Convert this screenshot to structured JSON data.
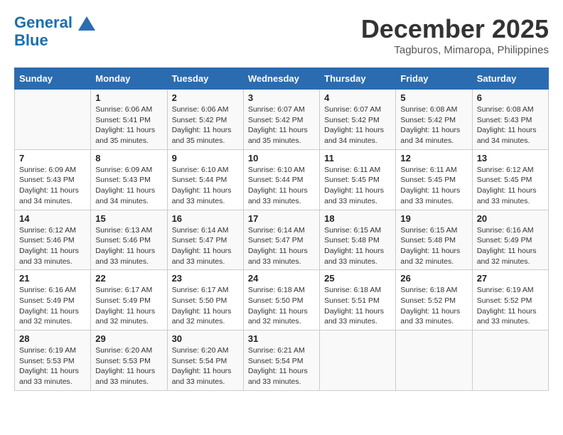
{
  "header": {
    "logo_line1": "General",
    "logo_line2": "Blue",
    "month": "December 2025",
    "location": "Tagburos, Mimaropa, Philippines"
  },
  "weekdays": [
    "Sunday",
    "Monday",
    "Tuesday",
    "Wednesday",
    "Thursday",
    "Friday",
    "Saturday"
  ],
  "weeks": [
    [
      {
        "day": "",
        "sunrise": "",
        "sunset": "",
        "daylight": ""
      },
      {
        "day": "1",
        "sunrise": "6:06 AM",
        "sunset": "5:41 PM",
        "daylight": "11 hours and 35 minutes."
      },
      {
        "day": "2",
        "sunrise": "6:06 AM",
        "sunset": "5:42 PM",
        "daylight": "11 hours and 35 minutes."
      },
      {
        "day": "3",
        "sunrise": "6:07 AM",
        "sunset": "5:42 PM",
        "daylight": "11 hours and 35 minutes."
      },
      {
        "day": "4",
        "sunrise": "6:07 AM",
        "sunset": "5:42 PM",
        "daylight": "11 hours and 34 minutes."
      },
      {
        "day": "5",
        "sunrise": "6:08 AM",
        "sunset": "5:42 PM",
        "daylight": "11 hours and 34 minutes."
      },
      {
        "day": "6",
        "sunrise": "6:08 AM",
        "sunset": "5:43 PM",
        "daylight": "11 hours and 34 minutes."
      }
    ],
    [
      {
        "day": "7",
        "sunrise": "6:09 AM",
        "sunset": "5:43 PM",
        "daylight": "11 hours and 34 minutes."
      },
      {
        "day": "8",
        "sunrise": "6:09 AM",
        "sunset": "5:43 PM",
        "daylight": "11 hours and 34 minutes."
      },
      {
        "day": "9",
        "sunrise": "6:10 AM",
        "sunset": "5:44 PM",
        "daylight": "11 hours and 33 minutes."
      },
      {
        "day": "10",
        "sunrise": "6:10 AM",
        "sunset": "5:44 PM",
        "daylight": "11 hours and 33 minutes."
      },
      {
        "day": "11",
        "sunrise": "6:11 AM",
        "sunset": "5:45 PM",
        "daylight": "11 hours and 33 minutes."
      },
      {
        "day": "12",
        "sunrise": "6:11 AM",
        "sunset": "5:45 PM",
        "daylight": "11 hours and 33 minutes."
      },
      {
        "day": "13",
        "sunrise": "6:12 AM",
        "sunset": "5:45 PM",
        "daylight": "11 hours and 33 minutes."
      }
    ],
    [
      {
        "day": "14",
        "sunrise": "6:12 AM",
        "sunset": "5:46 PM",
        "daylight": "11 hours and 33 minutes."
      },
      {
        "day": "15",
        "sunrise": "6:13 AM",
        "sunset": "5:46 PM",
        "daylight": "11 hours and 33 minutes."
      },
      {
        "day": "16",
        "sunrise": "6:14 AM",
        "sunset": "5:47 PM",
        "daylight": "11 hours and 33 minutes."
      },
      {
        "day": "17",
        "sunrise": "6:14 AM",
        "sunset": "5:47 PM",
        "daylight": "11 hours and 33 minutes."
      },
      {
        "day": "18",
        "sunrise": "6:15 AM",
        "sunset": "5:48 PM",
        "daylight": "11 hours and 33 minutes."
      },
      {
        "day": "19",
        "sunrise": "6:15 AM",
        "sunset": "5:48 PM",
        "daylight": "11 hours and 32 minutes."
      },
      {
        "day": "20",
        "sunrise": "6:16 AM",
        "sunset": "5:49 PM",
        "daylight": "11 hours and 32 minutes."
      }
    ],
    [
      {
        "day": "21",
        "sunrise": "6:16 AM",
        "sunset": "5:49 PM",
        "daylight": "11 hours and 32 minutes."
      },
      {
        "day": "22",
        "sunrise": "6:17 AM",
        "sunset": "5:49 PM",
        "daylight": "11 hours and 32 minutes."
      },
      {
        "day": "23",
        "sunrise": "6:17 AM",
        "sunset": "5:50 PM",
        "daylight": "11 hours and 32 minutes."
      },
      {
        "day": "24",
        "sunrise": "6:18 AM",
        "sunset": "5:50 PM",
        "daylight": "11 hours and 32 minutes."
      },
      {
        "day": "25",
        "sunrise": "6:18 AM",
        "sunset": "5:51 PM",
        "daylight": "11 hours and 33 minutes."
      },
      {
        "day": "26",
        "sunrise": "6:18 AM",
        "sunset": "5:52 PM",
        "daylight": "11 hours and 33 minutes."
      },
      {
        "day": "27",
        "sunrise": "6:19 AM",
        "sunset": "5:52 PM",
        "daylight": "11 hours and 33 minutes."
      }
    ],
    [
      {
        "day": "28",
        "sunrise": "6:19 AM",
        "sunset": "5:53 PM",
        "daylight": "11 hours and 33 minutes."
      },
      {
        "day": "29",
        "sunrise": "6:20 AM",
        "sunset": "5:53 PM",
        "daylight": "11 hours and 33 minutes."
      },
      {
        "day": "30",
        "sunrise": "6:20 AM",
        "sunset": "5:54 PM",
        "daylight": "11 hours and 33 minutes."
      },
      {
        "day": "31",
        "sunrise": "6:21 AM",
        "sunset": "5:54 PM",
        "daylight": "11 hours and 33 minutes."
      },
      {
        "day": "",
        "sunrise": "",
        "sunset": "",
        "daylight": ""
      },
      {
        "day": "",
        "sunrise": "",
        "sunset": "",
        "daylight": ""
      },
      {
        "day": "",
        "sunrise": "",
        "sunset": "",
        "daylight": ""
      }
    ]
  ]
}
